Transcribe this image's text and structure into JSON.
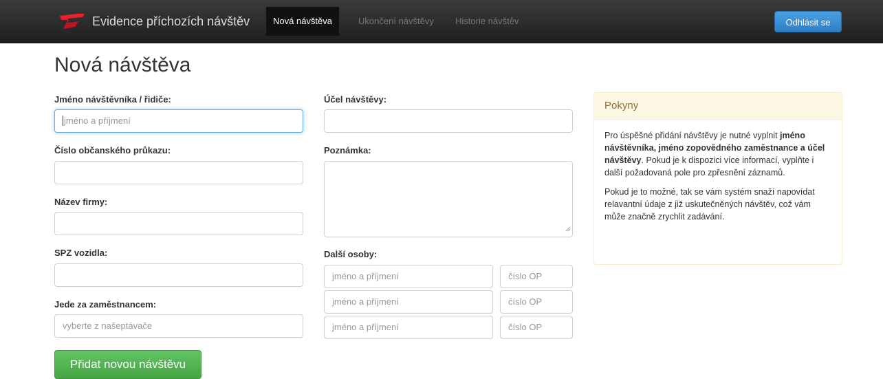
{
  "nav": {
    "brand_title": "Evidence příchozích návštěv",
    "items": [
      {
        "label": "Nová návštěva",
        "active": true
      },
      {
        "label": "Ukončení návštěvy",
        "active": false
      },
      {
        "label": "Historie návštěv",
        "active": false
      }
    ],
    "logout_label": "Odhlásit se"
  },
  "page": {
    "title": "Nová návštěva"
  },
  "form": {
    "visitor_name": {
      "label": "Jméno návštěvníka / řidiče:",
      "placeholder": "jméno a příjmení",
      "value": ""
    },
    "id_card": {
      "label": "Číslo občanského průkazu:",
      "value": ""
    },
    "company": {
      "label": "Název firmy:",
      "value": ""
    },
    "license_plate": {
      "label": "SPZ vozidla:",
      "value": ""
    },
    "visiting_employee": {
      "label": "Jede za zaměstnancem:",
      "placeholder": "vyberte z našeptávače"
    },
    "purpose": {
      "label": "Účel návštěvy:",
      "value": ""
    },
    "note": {
      "label": "Poznámka:",
      "value": ""
    },
    "other_persons": {
      "label": "Další osoby:",
      "rows": [
        {
          "name_placeholder": "jméno a příjmení",
          "id_placeholder": "číslo OP"
        },
        {
          "name_placeholder": "jméno a příjmení",
          "id_placeholder": "číslo OP"
        },
        {
          "name_placeholder": "jméno a příjmení",
          "id_placeholder": "číslo OP"
        }
      ]
    },
    "submit_label": "Přidat novou návštěvu"
  },
  "instructions": {
    "title": "Pokyny",
    "p1_a": "Pro úspěšné přidání návštěvy je nutné vyplnit ",
    "p1_bold": "jméno návštěvníka, jméno zopovědného zaměstnance a účel návštěvy",
    "p1_b": ". Pokud je k dispozici více informací, vyplňte i další požadovaná pole pro zpřesnění záznamů.",
    "p2": "Pokud je to možné, tak se vám systém snaží napovídat relavantní údaje z již uskutečněných návštěv, což vám může značně zrychlit zadávání."
  },
  "colors": {
    "navbar": "#2a2a2a",
    "logo_red": "#e8212e",
    "primary_button": "#3a8ed3",
    "success_button": "#51b051",
    "panel_warning": "#fcf8e3"
  },
  "icons": {
    "brand_logo": "red-angular-logo",
    "textarea_resize": "resize-grip-icon"
  }
}
